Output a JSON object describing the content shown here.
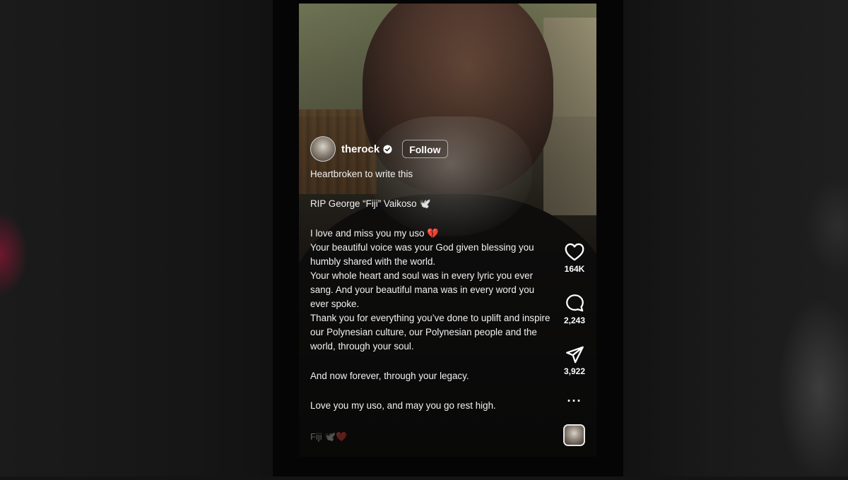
{
  "post": {
    "username": "therock",
    "follow_label": "Follow",
    "caption": {
      "line1": "Heartbroken to write this",
      "line2": "RIP George “Fiji” Vaikoso 🕊️",
      "line3": "I love and miss you my uso 💔",
      "line4": "Your beautiful voice was your God given blessing you humbly shared with the world.",
      "line5": "Your whole heart and soul was in every lyric you ever sang. And your beautiful mana was in every word you ever spoke.",
      "line6": "Thank you for everything you’ve done to uplift and inspire our Polynesian culture, our Polynesian people and the world, through your soul.",
      "line7": "And now forever, through your legacy.",
      "line8": "Love you my uso, and may you go rest high."
    },
    "faded_text": "Fiji 🕊️❤️"
  },
  "actions": {
    "likes": "164K",
    "comments": "2,243",
    "shares": "3,922",
    "more_label": "···"
  },
  "icons": {
    "like": "heart-icon",
    "comment": "comment-icon",
    "share": "send-icon",
    "more": "more-icon",
    "verified": "verified-badge-icon"
  },
  "colors": {
    "text": "#ffffff",
    "background": "#050505",
    "verified_badge": "#ffffff"
  }
}
